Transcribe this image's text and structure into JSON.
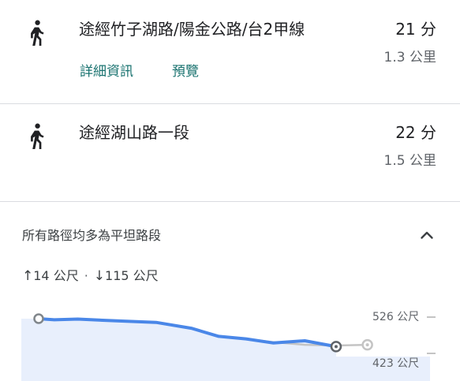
{
  "routes": [
    {
      "icon": "walk-icon",
      "via": "途經竹子湖路/陽金公路/台2甲線",
      "time": "21 分",
      "distance": "1.3 公里",
      "links": {
        "details": "詳細資訊",
        "preview": "預覽"
      }
    },
    {
      "icon": "walk-icon",
      "via": "途經湖山路一段",
      "time": "22 分",
      "distance": "1.5 公里"
    }
  ],
  "elevation": {
    "summary": "所有路徑均多為平坦路段",
    "collapse_icon": "chevron-up-icon",
    "ascent": "14 公尺",
    "descent": "115 公尺",
    "ascent_arrow": "↑",
    "descent_arrow": "↓",
    "separator": "·",
    "max_label": "526 公尺",
    "min_label": "423 公尺",
    "colors": {
      "selected_line": "#4a87e8",
      "alt_line": "#c4c4c4",
      "fill": "#e8effc"
    }
  },
  "chart_data": {
    "type": "area",
    "ylim": [
      423,
      526
    ],
    "series": [
      {
        "x": [
          0,
          0.04,
          0.1,
          0.2,
          0.3,
          0.39,
          0.46,
          0.53,
          0.6,
          0.68,
          0.76
        ],
        "y": [
          526,
          523,
          525,
          520,
          516,
          500,
          478,
          471,
          460,
          466,
          450
        ]
      },
      {
        "x": [
          0.46,
          0.53,
          0.6,
          0.68,
          0.76,
          0.84
        ],
        "y": [
          478,
          471,
          462,
          455,
          453,
          455
        ]
      }
    ]
  }
}
